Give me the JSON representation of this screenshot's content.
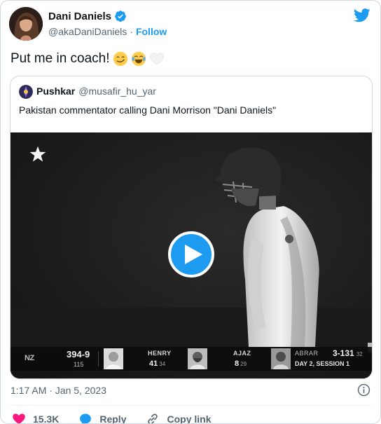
{
  "author": {
    "display_name": "Dani Daniels",
    "handle": "@akaDaniDaniels",
    "separator": "·",
    "follow_label": "Follow"
  },
  "tweet": {
    "text": "Put me in coach!"
  },
  "quoted": {
    "display_name": "Pushkar",
    "handle": "@musafir_hu_yar",
    "text": "Pakistan commentator calling Dani Morrison \"Dani Daniels\""
  },
  "video": {
    "scorebar": {
      "team_logo": "NZ",
      "score": "394-9",
      "overs": "115",
      "batter1": {
        "name": "HENRY",
        "runs": "41",
        "balls": "34"
      },
      "batter2": {
        "name": "AJAZ",
        "runs": "8",
        "balls": "29"
      },
      "bowler": {
        "name": "ABRAR",
        "figures": "3-131",
        "overs": "32"
      },
      "session": "DAY 2, SESSION 1"
    }
  },
  "meta": {
    "timestamp": "1:17 AM · Jan 5, 2023"
  },
  "actions": {
    "like_count": "15.3K",
    "reply_label": "Reply",
    "copy_link_label": "Copy link"
  },
  "colors": {
    "accent": "#1d9bf0",
    "like": "#f91880",
    "text": "#0f1419",
    "muted": "#536471"
  },
  "icons": [
    "verified-badge-icon",
    "twitter-bird-icon",
    "smirk-emoji-icon",
    "joy-emoji-icon",
    "white-heart-emoji-icon",
    "star-icon",
    "play-icon",
    "info-icon",
    "heart-icon",
    "reply-icon",
    "link-icon"
  ]
}
